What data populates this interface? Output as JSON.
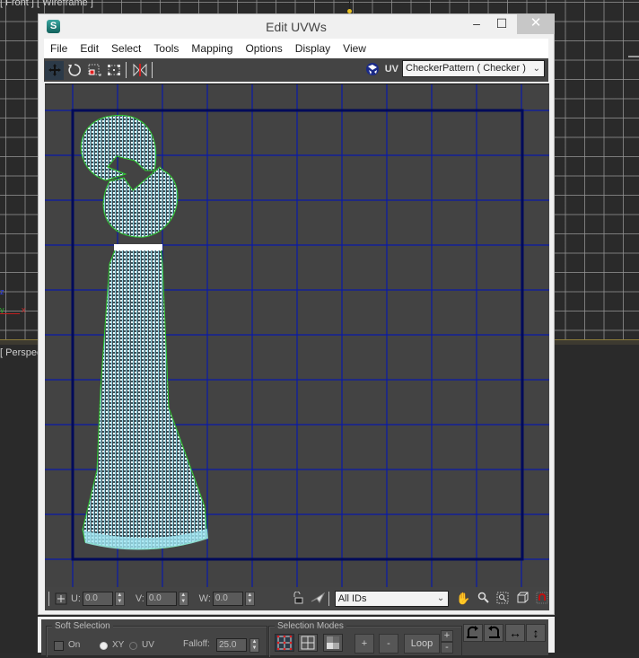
{
  "background": {
    "top_viewport_label": "[ Front ] [ Wireframe ]",
    "bottom_viewport_label": "[ Perspec",
    "axis_labels": {
      "x": "x",
      "y": "y",
      "z": "z"
    }
  },
  "window": {
    "title": "Edit UVWs",
    "app_icon": "3ds-max-logo-icon",
    "controls": {
      "minimize": "–",
      "maximize": "☐",
      "close": "✕"
    }
  },
  "menu": [
    "File",
    "Edit",
    "Select",
    "Tools",
    "Mapping",
    "Options",
    "Display",
    "View"
  ],
  "toolbar": {
    "tools": [
      {
        "name": "move-tool",
        "icon": "move-icon",
        "active": true
      },
      {
        "name": "rotate-tool",
        "icon": "rotate-icon"
      },
      {
        "name": "scale-tool",
        "icon": "scale-icon"
      },
      {
        "name": "freeform-tool",
        "icon": "freeform-icon"
      },
      {
        "name": "mirror-tool",
        "icon": "mirror-icon"
      }
    ],
    "uv_label": "UV",
    "texture_select": "CheckerPattern  ( Checker )"
  },
  "uv_editor": {
    "grid_color": "#0a1aa8",
    "bounds_color": "#000a5a",
    "background_color": "#434343",
    "wire_color": "#9fe3f0",
    "edge_color": "#2ec92e"
  },
  "bottombar": {
    "u_label": "U:",
    "u_value": "0.0",
    "v_label": "V:",
    "v_value": "0.0",
    "w_label": "W:",
    "w_value": "0.0",
    "id_select": "All IDs"
  },
  "soft_selection": {
    "title": "Soft Selection",
    "on_label": "On",
    "on_checked": false,
    "xy_label": "XY",
    "uv_label": "UV",
    "mode": "XY",
    "falloff_label": "Falloff:",
    "falloff_value": "25.0"
  },
  "selection_modes": {
    "title": "Selection Modes",
    "plus": "+",
    "minus": "-",
    "loop": "Loop",
    "loop_plus": "+",
    "loop_minus": "-"
  }
}
